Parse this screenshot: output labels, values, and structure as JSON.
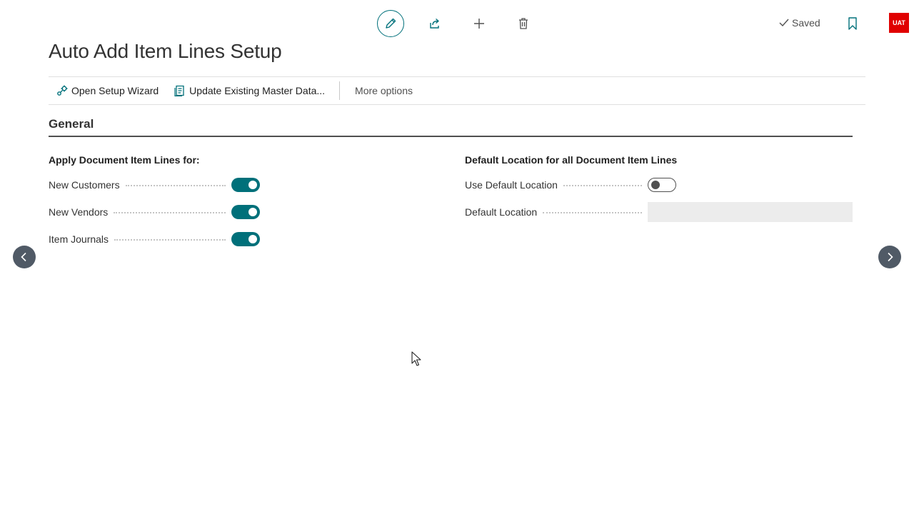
{
  "header": {
    "actions": [
      {
        "name": "edit",
        "icon": "pencil-icon"
      },
      {
        "name": "share",
        "icon": "share-icon"
      },
      {
        "name": "new",
        "icon": "plus-icon"
      },
      {
        "name": "delete",
        "icon": "trash-icon"
      }
    ],
    "status": "Saved",
    "environment_badge": "UAT",
    "colors": {
      "accent": "#00707a",
      "badge": "#e00000"
    }
  },
  "page": {
    "title": "Auto Add Item Lines Setup"
  },
  "action_bar": {
    "open_setup_wizard": "Open Setup Wizard",
    "update_master_data": "Update Existing Master Data...",
    "more_options": "More options"
  },
  "general": {
    "title": "General",
    "apply_group": {
      "caption": "Apply Document Item Lines for:",
      "fields": [
        {
          "label": "New Customers",
          "value": true
        },
        {
          "label": "New Vendors",
          "value": true
        },
        {
          "label": "Item Journals",
          "value": true
        }
      ]
    },
    "location_group": {
      "caption": "Default Location for all Document Item Lines",
      "use_default_location": {
        "label": "Use Default Location",
        "value": false
      },
      "default_location": {
        "label": "Default Location",
        "value": ""
      }
    }
  }
}
